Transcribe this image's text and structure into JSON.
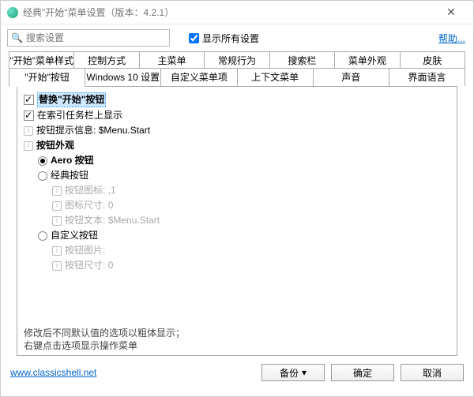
{
  "window": {
    "title": "经典\"开始\"菜单设置（版本：4.2.1）",
    "close_icon": "✕"
  },
  "toolbar": {
    "search_icon": "🔍",
    "search_placeholder": "搜索设置",
    "show_all_label": "显示所有设置",
    "help_label": "帮助..."
  },
  "tabs_row1": [
    "\"开始\"菜单样式",
    "控制方式",
    "主菜单",
    "常规行为",
    "搜索栏",
    "菜单外观",
    "皮肤"
  ],
  "tabs_row2": [
    "\"开始\"按钮",
    "Windows 10 设置",
    "自定义菜单项",
    "上下文菜单",
    "声音",
    "界面语言"
  ],
  "active_tab": "\"开始\"按钮",
  "tree": {
    "replace_start": {
      "label": "替换\"开始\"按钮"
    },
    "show_taskbar": {
      "label": "在索引任务栏上显示"
    },
    "tooltip_info": {
      "label": "按钮提示信息:",
      "value": "$Menu.Start"
    },
    "appearance": {
      "label": "按钮外观"
    },
    "aero_btn": {
      "label": "Aero 按钮"
    },
    "classic_btn": {
      "label": "经典按钮"
    },
    "btn_icon": {
      "label": "按钮图标:",
      "value": ",1"
    },
    "icon_size": {
      "label": "图标尺寸:",
      "value": "0"
    },
    "btn_text": {
      "label": "按钮文本:",
      "value": "$Menu.Start"
    },
    "custom_btn": {
      "label": "自定义按钮"
    },
    "btn_image": {
      "label": "按钮图片:"
    },
    "btn_size": {
      "label": "按钮尺寸:",
      "value": "0"
    }
  },
  "hints": {
    "line1": "修改后不同默认值的选项以粗体显示；",
    "line2": "右键点击选项显示操作菜单"
  },
  "footer": {
    "site": "www.classicshell.net",
    "backup": "备份",
    "ok": "确定",
    "cancel": "取消",
    "caret": "▾"
  }
}
